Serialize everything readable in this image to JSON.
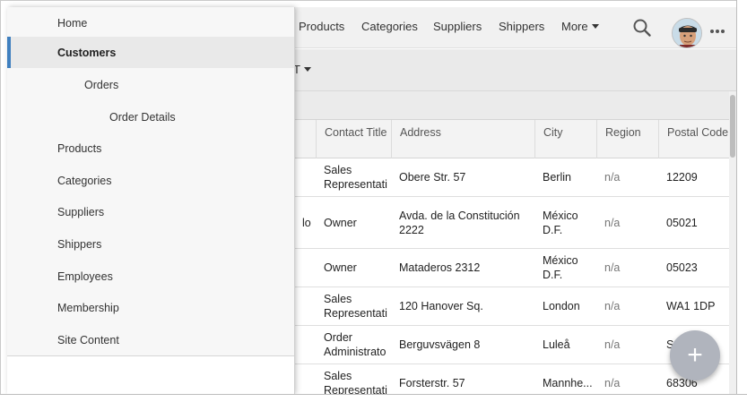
{
  "topnav": {
    "links": [
      "Products",
      "Categories",
      "Suppliers",
      "Shippers"
    ],
    "more_label": "More"
  },
  "toolbar": {
    "view_label": "T"
  },
  "table": {
    "columns": [
      "Contact Title",
      "Address",
      "City",
      "Region",
      "Postal Code"
    ],
    "partial_col": [
      "",
      "lo",
      "",
      "",
      "",
      ""
    ],
    "rows": [
      {
        "title": "Sales\nRepresentati",
        "address": "Obere Str. 57",
        "city": "Berlin",
        "region": "n/a",
        "postal": "12209"
      },
      {
        "title": "Owner",
        "address": "Avda. de la Constitución\n2222",
        "city": "México\nD.F.",
        "region": "n/a",
        "postal": "05021"
      },
      {
        "title": "Owner",
        "address": "Mataderos 2312",
        "city": "México\nD.F.",
        "region": "n/a",
        "postal": "05023"
      },
      {
        "title": "Sales\nRepresentati",
        "address": "120 Hanover Sq.",
        "city": "London",
        "region": "n/a",
        "postal": "WA1 1DP"
      },
      {
        "title": "Order\nAdministrato",
        "address": "Berguvsvägen 8",
        "city": "Luleå",
        "region": "n/a",
        "postal": "S"
      },
      {
        "title": "Sales\nRepresentati",
        "address": "Forsterstr. 57",
        "city": "Mannhe...",
        "region": "n/a",
        "postal": "68306"
      }
    ]
  },
  "sidebar": {
    "items": [
      {
        "label": "Home",
        "indent": 0
      },
      {
        "label": "Customers",
        "indent": 0,
        "selected": true
      },
      {
        "label": "Orders",
        "indent": 1
      },
      {
        "label": "Order Details",
        "indent": 2
      },
      {
        "label": "Products",
        "indent": 0
      },
      {
        "label": "Categories",
        "indent": 0
      },
      {
        "label": "Suppliers",
        "indent": 0
      },
      {
        "label": "Shippers",
        "indent": 0
      },
      {
        "label": "Employees",
        "indent": 0
      },
      {
        "label": "Membership",
        "indent": 0
      },
      {
        "label": "Site Content",
        "indent": 0
      }
    ]
  },
  "fab": {
    "label": "+"
  },
  "icons": {
    "search": "search-icon",
    "more": "more-horizontal-icon",
    "avatar": "user-avatar",
    "add": "plus-icon"
  },
  "colors": {
    "accent": "#3f7fbf",
    "fab": "#b0b4bd",
    "drawer_bg": "#f7f7f7",
    "appbar_bg": "#f1f1f1"
  }
}
